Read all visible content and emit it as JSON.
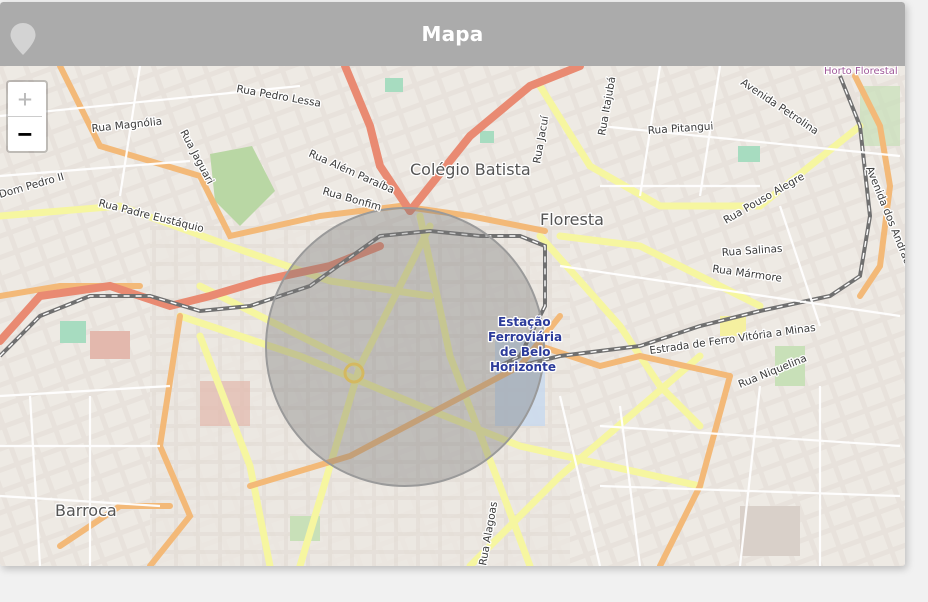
{
  "header": {
    "title": "Mapa",
    "icon": "map-pin-icon"
  },
  "zoom": {
    "in_label": "+",
    "out_label": "−",
    "in_disabled": true
  },
  "map": {
    "labels": {
      "rua_pedro_lessa": "Rua Pedro Lessa",
      "rua_magnolia": "Rua Magnólia",
      "rua_jaguari": "Rua Jaguari",
      "rua_alem_paraiba": "Rua Além Paraíba",
      "rua_bonfim": "Rua Bonfim",
      "colegio_batista": "Colégio Batista",
      "rua_jacui": "Rua Jacuí",
      "rua_itajuba": "Rua Itajubá",
      "rua_pitangui": "Rua Pitangui",
      "avenida_petrolina": "Avenida Petrolina",
      "horto_florestal": "Horto Florestal",
      "avenida_dos_andradas": "Avenida dos Andradas",
      "floresta": "Floresta",
      "rua_pouso_alegre": "Rua Pouso Alegre",
      "rua_salinas": "Rua Salinas",
      "rua_marmore": "Rua Mármore",
      "dom_pedro_ii": "Dom Pedro II",
      "rua_padre_eustaquio": "Rua Padre Eustáquio",
      "estacao_line1": "Estação",
      "estacao_line2": "Ferroviária",
      "estacao_line3": "de Belo",
      "estacao_line4": "Horizonte",
      "estrada_ferro": "Estrada de Ferro Vitória a Minas",
      "rua_niquelina": "Rua Niquelina",
      "barroca": "Barroca",
      "rua_alagoas": "Rua Alagoas",
      "colors": {
        "background": "#f2efe9",
        "primary_road": "#e8927c",
        "secondary_road": "#f7c383",
        "tertiary_road": "#f6f6a0",
        "railway": "#707070",
        "park": "#c8e0b8",
        "circle_fill": "#7a7a7a"
      }
    }
  }
}
